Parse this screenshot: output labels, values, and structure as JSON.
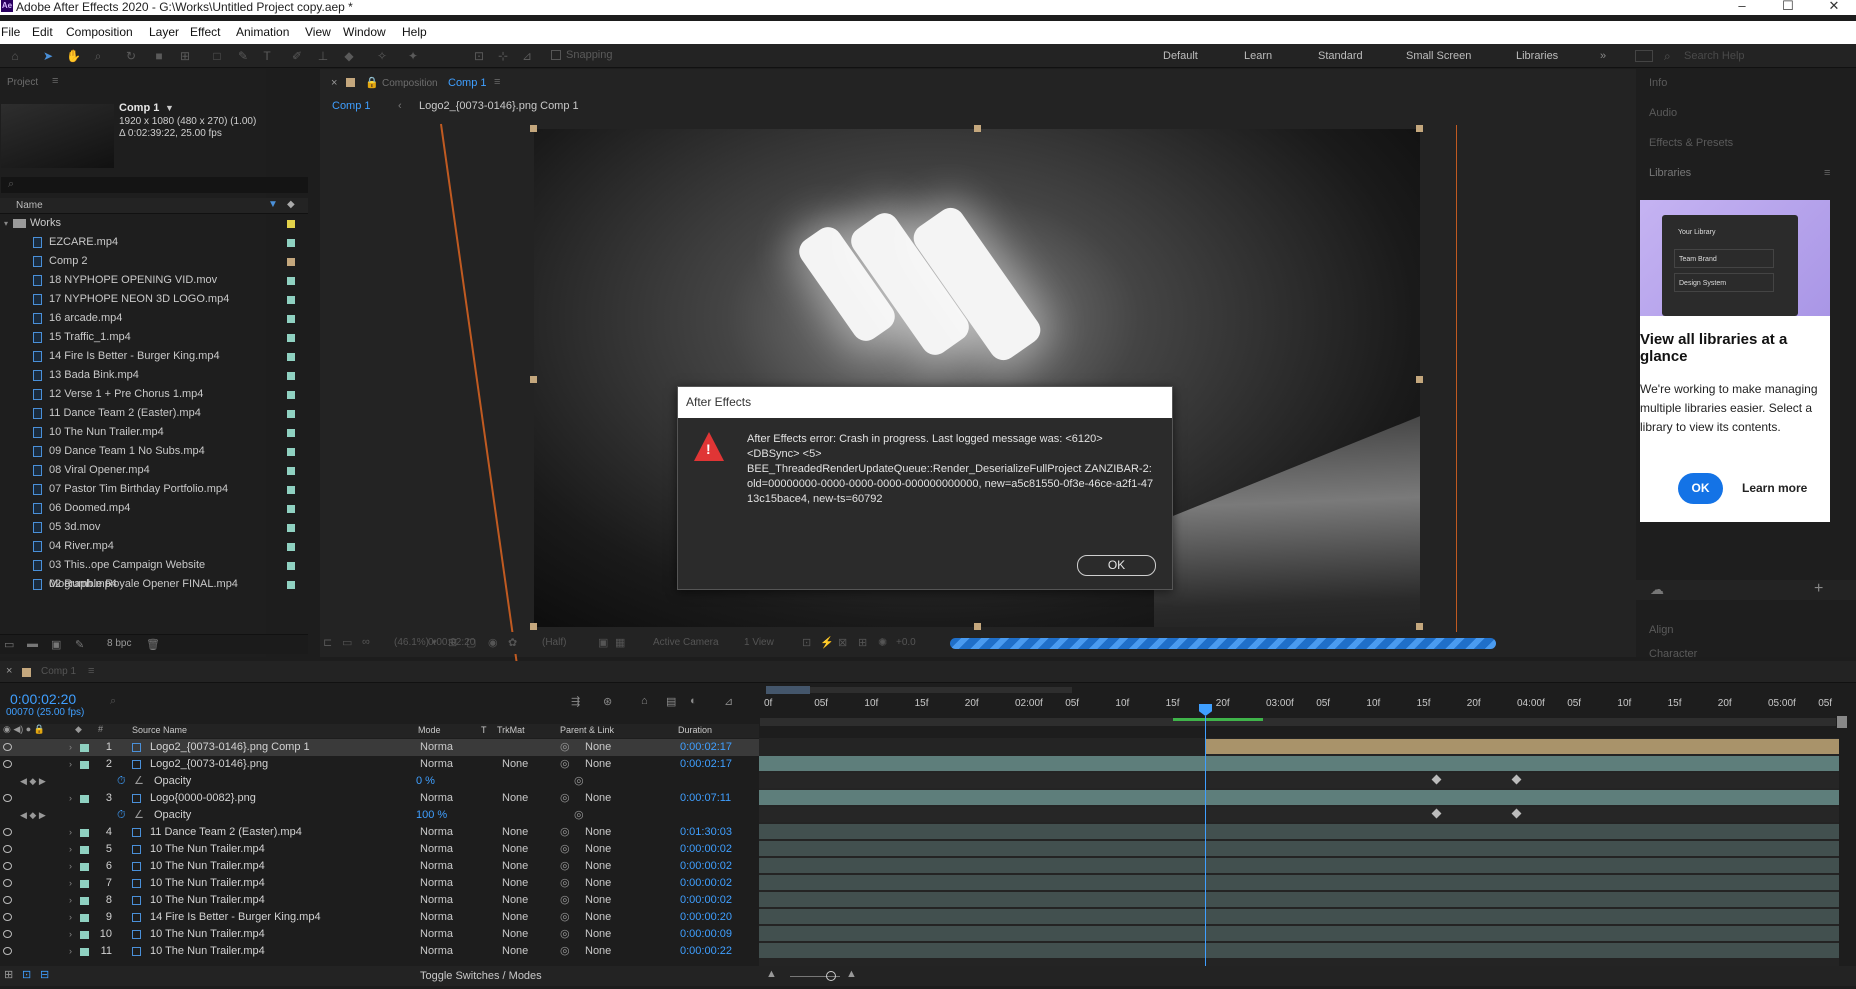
{
  "window": {
    "title": "Adobe After Effects 2020 - G:\\Works\\Untitled Project copy.aep *",
    "logo_text": "Ae"
  },
  "menu": [
    "File",
    "Edit",
    "Composition",
    "Layer",
    "Effect",
    "Animation",
    "View",
    "Window",
    "Help"
  ],
  "toolbar": {
    "snapping_label": "Snapping",
    "workspaces": [
      "Default",
      "Learn",
      "Standard",
      "Small Screen",
      "Libraries"
    ],
    "search_placeholder": "Search Help"
  },
  "project": {
    "panel_title": "Project",
    "comp_name": "Comp 1",
    "comp_info_1": "1920 x 1080  (480 x 270) (1.00)",
    "comp_info_2": "Δ 0:02:39:22, 25.00 fps",
    "name_header": "Name",
    "folder": "Works",
    "items": [
      "EZCARE.mp4",
      "Comp 2",
      "18 NYPHOPE OPENING VID.mov",
      "17 NYPHOPE NEON 3D LOGO.mp4",
      "16 arcade.mp4",
      "15 Traffic_1.mp4",
      "14 Fire Is Better - Burger King.mp4",
      "13 Bada Bink.mp4",
      "12 Verse 1 + Pre Chorus 1.mp4",
      "11 Dance Team 2 (Easter).mp4",
      "10 The Nun Trailer.mp4",
      "09 Dance Team 1 No Subs.mp4",
      "08 Viral Opener.mp4",
      "07 Pastor Tim Birthday Portfolio.mp4",
      "06 Doomed.mp4",
      "05 3d.mov",
      "04 River.mp4",
      "03 This..ope Campaign Website Mograph.mp4",
      "02 Rumble Royale Opener FINAL.mp4"
    ],
    "bpc": "8 bpc"
  },
  "composition": {
    "panel_prefix": "Composition",
    "panel_name": "Comp 1",
    "breadcrumb_1": "Comp 1",
    "breadcrumb_2": "Logo2_{0073-0146}.png Comp 1",
    "zoom": "(46.1%)",
    "timecode": "0:00:02:20",
    "resolution": "(Half)",
    "camera": "Active Camera",
    "views": "1 View",
    "exposure": "+0.0",
    "render_progress": 1.0
  },
  "dialog": {
    "title": "After Effects",
    "message_1": "After Effects error: Crash in progress. Last logged message was: <6120>",
    "message_2": "<DBSync> <5>",
    "message_3": "BEE_ThreadedRenderUpdateQueue::Render_DeserializeFullProject ZANZIBAR-2: old=00000000-0000-0000-0000-000000000000, new=a5c81550-0f3e-46ce-a2f1-4713c15bace4, new-ts=60792",
    "ok_label": "OK"
  },
  "right_panel": {
    "sections": [
      "Info",
      "Audio",
      "Effects & Presets",
      "Libraries"
    ],
    "lower_sections": [
      "Align",
      "Character"
    ],
    "library_card": {
      "items": [
        "Your Library",
        "Team Brand",
        "Design System"
      ],
      "heading": "View all libraries at a glance",
      "body": "We're working to make managing multiple libraries easier. Select a library to view its contents.",
      "ok_label": "OK",
      "learn_more_label": "Learn more"
    }
  },
  "timeline": {
    "tab": "Comp 1",
    "current_time": "0:00:02:20",
    "frames": "00070 (25.00 fps)",
    "headers": {
      "source_name": "Source Name",
      "mode": "Mode",
      "t": "T",
      "trkmat": "TrkMat",
      "parent": "Parent & Link",
      "duration": "Duration"
    },
    "ruler": [
      "0f",
      "05f",
      "10f",
      "15f",
      "20f",
      "02:00f",
      "05f",
      "10f",
      "15f",
      "20f",
      "03:00f",
      "05f",
      "10f",
      "15f",
      "20f",
      "04:00f",
      "05f",
      "10f",
      "15f",
      "20f",
      "05:00f",
      "05f"
    ],
    "layers": [
      {
        "num": "1",
        "name": "Logo2_{0073-0146}.png Comp 1",
        "mode": "Norma",
        "trkmat": "",
        "parent": "None",
        "duration": "0:00:02:17"
      },
      {
        "num": "2",
        "name": "Logo2_{0073-0146}.png",
        "mode": "Norma",
        "trkmat": "None",
        "parent": "None",
        "duration": "0:00:02:17"
      },
      {
        "num": "",
        "name": "Opacity",
        "mode": "0 %",
        "trkmat": "",
        "parent": "",
        "duration": ""
      },
      {
        "num": "3",
        "name": "Logo{0000-0082}.png",
        "mode": "Norma",
        "trkmat": "None",
        "parent": "None",
        "duration": "0:00:07:11"
      },
      {
        "num": "",
        "name": "Opacity",
        "mode": "100 %",
        "trkmat": "",
        "parent": "",
        "duration": ""
      },
      {
        "num": "4",
        "name": "11 Dance Team 2 (Easter).mp4",
        "mode": "Norma",
        "trkmat": "None",
        "parent": "None",
        "duration": "0:01:30:03"
      },
      {
        "num": "5",
        "name": "10 The Nun Trailer.mp4",
        "mode": "Norma",
        "trkmat": "None",
        "parent": "None",
        "duration": "0:00:00:02"
      },
      {
        "num": "6",
        "name": "10 The Nun Trailer.mp4",
        "mode": "Norma",
        "trkmat": "None",
        "parent": "None",
        "duration": "0:00:00:02"
      },
      {
        "num": "7",
        "name": "10 The Nun Trailer.mp4",
        "mode": "Norma",
        "trkmat": "None",
        "parent": "None",
        "duration": "0:00:00:02"
      },
      {
        "num": "8",
        "name": "10 The Nun Trailer.mp4",
        "mode": "Norma",
        "trkmat": "None",
        "parent": "None",
        "duration": "0:00:00:02"
      },
      {
        "num": "9",
        "name": "14 Fire Is Better - Burger King.mp4",
        "mode": "Norma",
        "trkmat": "None",
        "parent": "None",
        "duration": "0:00:00:20"
      },
      {
        "num": "10",
        "name": "10 The Nun Trailer.mp4",
        "mode": "Norma",
        "trkmat": "None",
        "parent": "None",
        "duration": "0:00:00:09"
      },
      {
        "num": "11",
        "name": "10 The Nun Trailer.mp4",
        "mode": "Norma",
        "trkmat": "None",
        "parent": "None",
        "duration": "0:00:00:22"
      }
    ],
    "toggle_label": "Toggle Switches / Modes"
  },
  "colors": {
    "accent": "#3f9fff",
    "label_teal": "#8fd1c1",
    "label_tan": "#c4a77d",
    "error_red": "#e03535",
    "adobe_blue": "#1473e6"
  }
}
